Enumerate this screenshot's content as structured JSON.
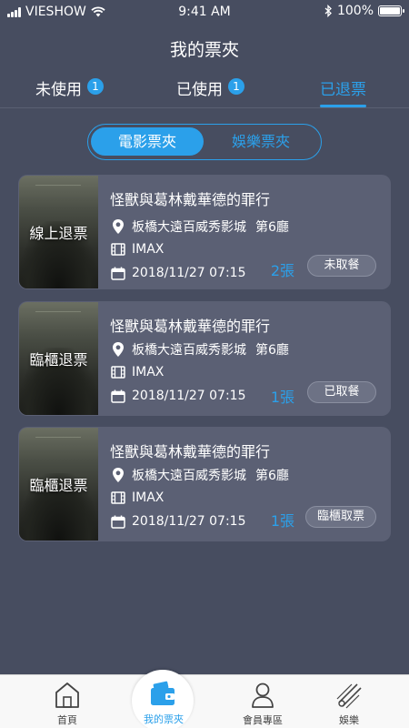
{
  "status_bar": {
    "carrier": "VIESHOW",
    "time": "9:41 AM",
    "battery": "100%"
  },
  "header": {
    "title": "我的票夾"
  },
  "tabs": [
    {
      "label": "未使用",
      "badge": "1"
    },
    {
      "label": "已使用",
      "badge": "1"
    },
    {
      "label": "已退票",
      "badge": ""
    }
  ],
  "segment": [
    {
      "label": "電影票夾"
    },
    {
      "label": "娛樂票夾"
    }
  ],
  "tickets": [
    {
      "poster_label": "線上退票",
      "title": "怪獸與葛林戴華德的罪行",
      "cinema": "板橋大遠百威秀影城",
      "hall": "第6廳",
      "format": "IMAX",
      "datetime": "2018/11/27 07:15",
      "count": "2張",
      "status": "未取餐"
    },
    {
      "poster_label": "臨櫃退票",
      "title": "怪獸與葛林戴華德的罪行",
      "cinema": "板橋大遠百威秀影城",
      "hall": "第6廳",
      "format": "IMAX",
      "datetime": "2018/11/27 07:15",
      "count": "1張",
      "status": "已取餐"
    },
    {
      "poster_label": "臨櫃退票",
      "title": "怪獸與葛林戴華德的罪行",
      "cinema": "板橋大遠百威秀影城",
      "hall": "第6廳",
      "format": "IMAX",
      "datetime": "2018/11/27 07:15",
      "count": "1張",
      "status": "臨櫃取票"
    }
  ],
  "bottom_nav": [
    {
      "label": "首頁",
      "icon": "home-icon"
    },
    {
      "label": "我的票夾",
      "icon": "ticket-wallet-icon"
    },
    {
      "label": "會員專區",
      "icon": "member-icon"
    },
    {
      "label": "娛樂",
      "icon": "entertainment-icon"
    }
  ],
  "colors": {
    "accent": "#2ba0ea",
    "background": "#474d60",
    "card": "#5b6074"
  }
}
